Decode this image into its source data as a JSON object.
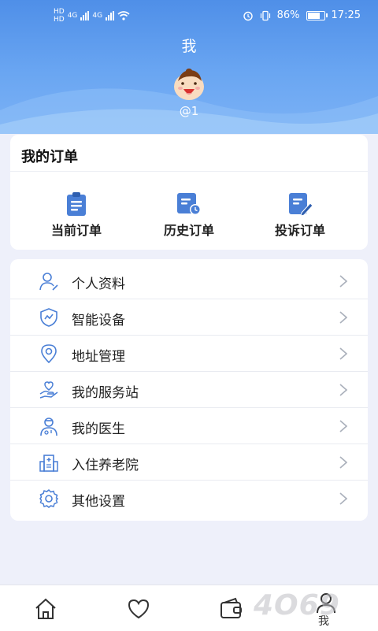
{
  "status_bar": {
    "net_left_top": "HD",
    "net_left_bottom": "HD",
    "sig1_label": "4G",
    "sig2_label": "4G",
    "battery": "86%",
    "time": "17:25"
  },
  "header": {
    "title": "我",
    "username": "@1"
  },
  "orders": {
    "title": "我的订单",
    "items": [
      {
        "label": "当前订单",
        "icon": "clipboard-icon"
      },
      {
        "label": "历史订单",
        "icon": "history-order-icon"
      },
      {
        "label": "投诉订单",
        "icon": "complaint-edit-icon"
      }
    ]
  },
  "menu": {
    "items": [
      {
        "label": "个人资料",
        "icon": "user-profile-icon"
      },
      {
        "label": "智能设备",
        "icon": "shield-device-icon"
      },
      {
        "label": "地址管理",
        "icon": "location-pin-icon"
      },
      {
        "label": "我的服务站",
        "icon": "hand-heart-icon"
      },
      {
        "label": "我的医生",
        "icon": "doctor-icon"
      },
      {
        "label": "入住养老院",
        "icon": "building-icon"
      },
      {
        "label": "其他设置",
        "icon": "gear-icon"
      }
    ]
  },
  "tabbar": {
    "tabs": [
      {
        "icon": "home-icon"
      },
      {
        "icon": "heart-icon"
      },
      {
        "icon": "wallet-icon"
      },
      {
        "icon": "profile-icon",
        "label": "我"
      }
    ]
  },
  "watermark": "4O69",
  "colors": {
    "header_start": "#4f8fe8",
    "header_end": "#7cb2f5",
    "accent": "#4a7fd6",
    "background": "#eef0fa"
  }
}
